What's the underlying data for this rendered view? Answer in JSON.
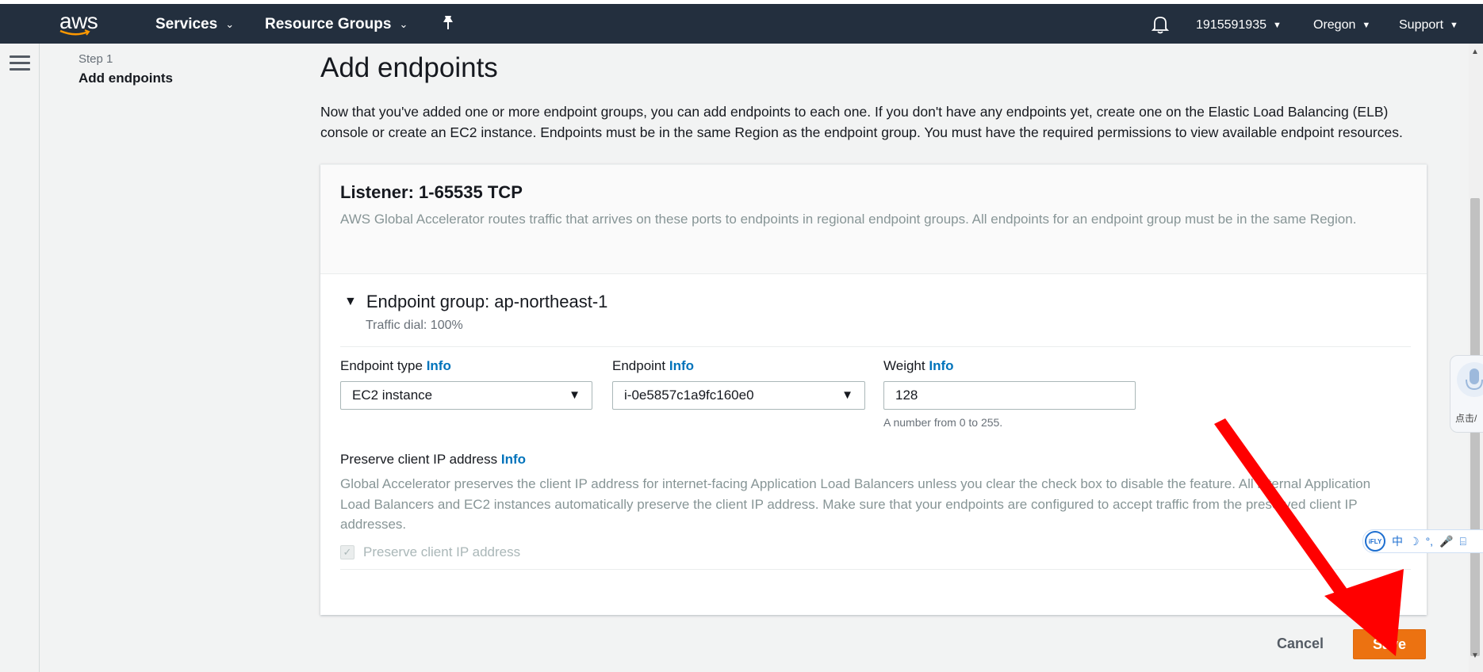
{
  "navbar": {
    "logo_text": "aws",
    "services_label": "Services",
    "resource_groups_label": "Resource Groups",
    "account_id": "1915591935",
    "region": "Oregon",
    "support": "Support"
  },
  "sidebar": {
    "step_label": "Step 1",
    "step_title": "Add endpoints"
  },
  "main": {
    "title": "Add endpoints",
    "intro": "Now that you've added one or more endpoint groups, you can add endpoints to each one. If you don't have any endpoints yet, create one on the Elastic Load Balancing (ELB) console or create an EC2 instance. Endpoints must be in the same Region as the endpoint group. You must have the required permissions to view available endpoint resources."
  },
  "listener": {
    "title": "Listener: 1-65535 TCP",
    "description": "AWS Global Accelerator routes traffic that arrives on these ports to endpoints in regional endpoint groups. All endpoints for an endpoint group must be in the same Region."
  },
  "endpoint_group": {
    "title": "Endpoint group: ap-northeast-1",
    "traffic_dial": "Traffic dial: 100%",
    "endpoint_type": {
      "label": "Endpoint type",
      "info": "Info",
      "value": "EC2 instance"
    },
    "endpoint": {
      "label": "Endpoint",
      "info": "Info",
      "value": "i-0e5857c1a9fc160e0"
    },
    "weight": {
      "label": "Weight",
      "info": "Info",
      "value": "128",
      "hint": "A number from 0 to 255."
    },
    "preserve_ip": {
      "label": "Preserve client IP address",
      "info": "Info",
      "description": "Global Accelerator preserves the client IP address for internet-facing Application Load Balancers unless you clear the check box to disable the feature. All internal Application Load Balancers and EC2 instances automatically preserve the client IP address. Make sure that your endpoints are configured to accept traffic from the preserved client IP addresses.",
      "checkbox_label": "Preserve client IP address",
      "checked": true
    }
  },
  "actions": {
    "cancel": "Cancel",
    "save": "Save"
  },
  "overlay": {
    "mic_text": "点击/",
    "ifly_logo": "iFLY",
    "ifly_items": [
      "中",
      "☽",
      "°,",
      "🎤",
      "⌸"
    ]
  },
  "colors": {
    "navbar_bg": "#232f3e",
    "link": "#0073bb",
    "primary_button": "#ec7211",
    "annotation_arrow": "#ff0000"
  }
}
